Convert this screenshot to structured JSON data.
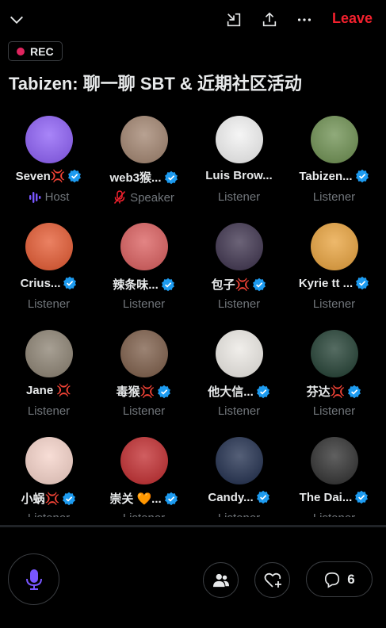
{
  "header": {
    "leave_label": "Leave",
    "rec_label": "REC",
    "title": "Tabizen: 聊一聊 SBT & 近期社区活动"
  },
  "participants": [
    {
      "name": "Seven💢",
      "verified": true,
      "role": "Host",
      "avatar_color": "#8b5cf6"
    },
    {
      "name": "web3猴...",
      "verified": true,
      "role": "Speaker",
      "avatar_color": "#a0826d"
    },
    {
      "name": "Luis Brow...",
      "verified": false,
      "role": "Listener",
      "avatar_color": "#f2f2f2"
    },
    {
      "name": "Tabizen...",
      "verified": true,
      "role": "Listener",
      "avatar_color": "#6b8e4e"
    },
    {
      "name": "Crius...",
      "verified": true,
      "role": "Listener",
      "avatar_color": "#e4572e"
    },
    {
      "name": "辣条味...",
      "verified": true,
      "role": "Listener",
      "avatar_color": "#d95b5b"
    },
    {
      "name": "包子💢",
      "verified": true,
      "role": "Listener",
      "avatar_color": "#3a2f4a"
    },
    {
      "name": "Kyrie tt ...",
      "verified": true,
      "role": "Listener",
      "avatar_color": "#e8a13a"
    },
    {
      "name": "Jane 💢",
      "verified": false,
      "role": "Listener",
      "avatar_color": "#8a8070"
    },
    {
      "name": "毒猴💢",
      "verified": true,
      "role": "Listener",
      "avatar_color": "#7a5a45"
    },
    {
      "name": "他大信...",
      "verified": true,
      "role": "Listener",
      "avatar_color": "#ece9e4"
    },
    {
      "name": "芬达💢",
      "verified": true,
      "role": "Listener",
      "avatar_color": "#1d3b2e"
    },
    {
      "name": "小蜗💢",
      "verified": true,
      "role": "Listener",
      "avatar_color": "#f5d2c8"
    },
    {
      "name": "崇关 🧡...",
      "verified": true,
      "role": "Listener",
      "avatar_color": "#c0282b"
    },
    {
      "name": "Candy...",
      "verified": true,
      "role": "Listener",
      "avatar_color": "#1c2a4a"
    },
    {
      "name": "The Dai...",
      "verified": true,
      "role": "Listener",
      "avatar_color": "#2b2b2b"
    }
  ],
  "footer": {
    "comment_count": "6"
  },
  "colors": {
    "accent": "#f4212e",
    "verified": "#1d9bf0",
    "host": "#7856ff",
    "mic": "#7856ff",
    "muted_speaker": "#f4212e"
  },
  "icons": [
    "chevron-down-icon",
    "minimize-icon",
    "share-icon",
    "more-icon",
    "verified-icon",
    "host-wave-icon",
    "mic-muted-icon",
    "mic-icon",
    "people-icon",
    "heart-add-icon",
    "comment-icon"
  ]
}
